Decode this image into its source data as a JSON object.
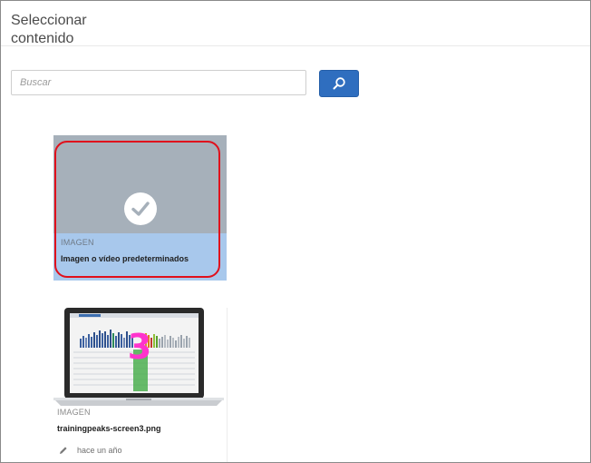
{
  "header": {
    "title_line1": "Seleccionar",
    "title_line2": "contenido"
  },
  "search": {
    "placeholder": "Buscar",
    "button_icon": "search-icon"
  },
  "cards": [
    {
      "type_label": "IMAGEN",
      "name": "Imagen o vídeo predeterminados",
      "selected": true,
      "icon": "checkmark-icon"
    },
    {
      "type_label": "IMAGEN",
      "name": "trainingpeaks-screen3.png",
      "modified": "hace un año",
      "annotation": "3",
      "icon": "pencil-icon"
    }
  ],
  "colors": {
    "accent": "#2f6ebf",
    "selection_outline": "#e0101c",
    "selected_card_bg": "#a8c8ec",
    "annotation": "#ff33cc"
  }
}
